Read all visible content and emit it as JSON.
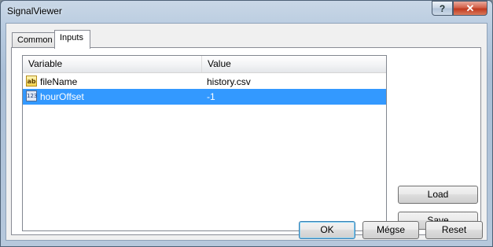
{
  "window": {
    "title": "SignalViewer",
    "help_label": "?",
    "close_label": "✕"
  },
  "tabs": [
    {
      "label": "Common",
      "active": false
    },
    {
      "label": "Inputs",
      "active": true
    }
  ],
  "inputs_table": {
    "columns": [
      "Variable",
      "Value"
    ],
    "rows": [
      {
        "icon": "string-type-icon",
        "icon_text": "ab",
        "variable": "fileName",
        "value": "history.csv",
        "selected": false
      },
      {
        "icon": "number-type-icon",
        "icon_text": "123",
        "variable": "hourOffset",
        "value": "-1",
        "selected": true
      }
    ]
  },
  "buttons": {
    "load": "Load",
    "save": "Save",
    "ok": "OK",
    "cancel": "Mégse",
    "reset": "Reset"
  },
  "colors": {
    "selection": "#3399ff",
    "close_button": "#c0391f"
  }
}
